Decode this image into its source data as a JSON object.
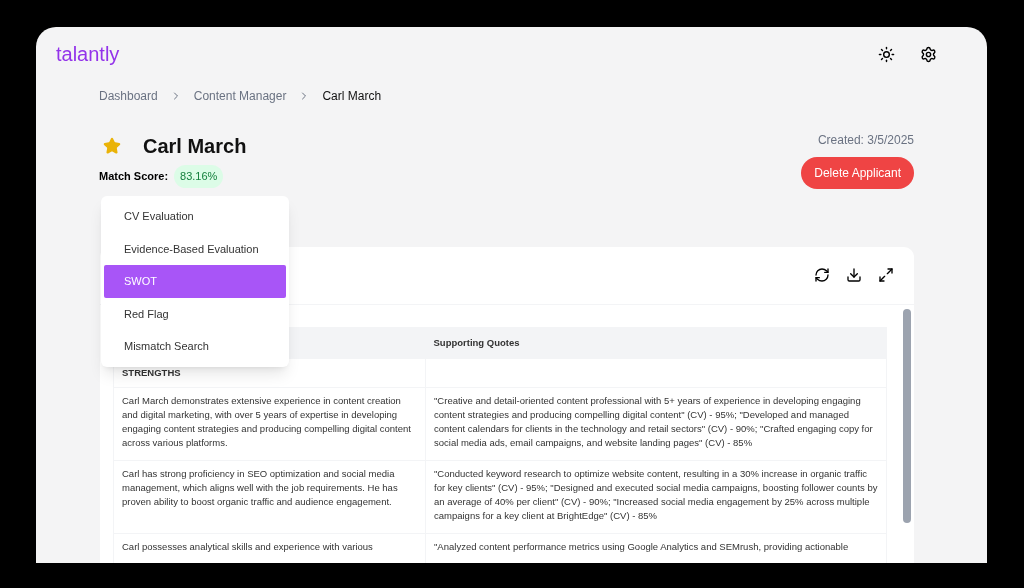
{
  "app": {
    "logo": "talantly"
  },
  "breadcrumb": [
    {
      "label": "Dashboard",
      "current": false
    },
    {
      "label": "Content Manager",
      "current": false
    },
    {
      "label": "Carl March",
      "current": true
    }
  ],
  "applicant": {
    "name": "Carl March",
    "favorite": true,
    "match_label": "Match Score:",
    "match_score": "83.16%",
    "created": "Created: 3/5/2025",
    "delete_button": "Delete Applicant"
  },
  "menu": [
    {
      "label": "CV Evaluation",
      "selected": false
    },
    {
      "label": "Evidence-Based Evaluation",
      "selected": false
    },
    {
      "label": "SWOT",
      "selected": true
    },
    {
      "label": "Red Flag",
      "selected": false
    },
    {
      "label": "Mismatch Search",
      "selected": false
    }
  ],
  "table": {
    "columns": [
      "",
      "Supporting Quotes"
    ],
    "rows": [
      {
        "kind": "section",
        "cells": [
          "STRENGTHS",
          ""
        ]
      },
      {
        "kind": "item",
        "cells": [
          "Carl March demonstrates extensive experience in content creation and digital marketing, with over 5 years of expertise in developing engaging content strategies and producing compelling digital content across various platforms.",
          "\"Creative and detail-oriented content professional with 5+ years of experience in developing engaging content strategies and producing compelling digital content\" (CV) - 95%; \"Developed and managed content calendars for clients in the technology and retail sectors\" (CV) - 90%; \"Crafted engaging copy for social media ads, email campaigns, and website landing pages\" (CV) - 85%"
        ]
      },
      {
        "kind": "item",
        "cells": [
          "Carl has strong proficiency in SEO optimization and social media management, which aligns well with the job requirements. He has proven ability to boost organic traffic and audience engagement.",
          "\"Conducted keyword research to optimize website content, resulting in a 30% increase in organic traffic for key clients\" (CV) - 95%; \"Designed and executed social media campaigns, boosting follower counts by an average of 40% per client\" (CV) - 90%; \"Increased social media engagement by 25% across multiple campaigns for a key client at BrightEdge\" (CV) - 85%"
        ]
      },
      {
        "kind": "item",
        "cells": [
          "Carl possesses analytical skills and experience with various",
          "\"Analyzed content performance metrics using Google Analytics and SEMrush, providing actionable"
        ]
      }
    ]
  }
}
